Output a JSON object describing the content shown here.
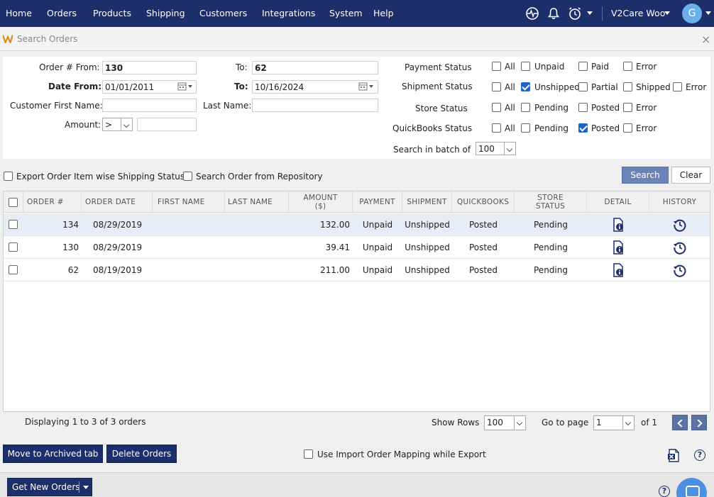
{
  "nav": {
    "items": [
      "Home",
      "Orders",
      "Products",
      "Shipping",
      "Customers",
      "Integrations",
      "System",
      "Help"
    ],
    "account": "V2Care Woo",
    "avatar_letter": "G"
  },
  "panel": {
    "title": "Search Orders",
    "close": "×"
  },
  "filter": {
    "order_from_label": "Order # From:",
    "order_from_value": "130",
    "order_to_label": "To:",
    "order_to_value": "62",
    "date_from_label": "Date From:",
    "date_from_value": "01/01/2011",
    "date_to_label": "To:",
    "date_to_value": "10/16/2024",
    "first_name_label": "Customer First Name:",
    "first_name_value": "",
    "last_name_label": "Last Name:",
    "last_name_value": "",
    "amount_label": "Amount:",
    "amount_op": ">",
    "amount_value": "",
    "payment": {
      "label": "Payment Status",
      "options": [
        {
          "label": "All",
          "checked": false
        },
        {
          "label": "Unpaid",
          "checked": false
        },
        {
          "label": "Paid",
          "checked": false
        },
        {
          "label": "Error",
          "checked": false
        }
      ]
    },
    "shipment": {
      "label": "Shipment Status",
      "options": [
        {
          "label": "All",
          "checked": false
        },
        {
          "label": "Unshipped",
          "checked": true
        },
        {
          "label": "Partial",
          "checked": false
        },
        {
          "label": "Shipped",
          "checked": false
        },
        {
          "label": "Error",
          "checked": false
        }
      ]
    },
    "store": {
      "label": "Store  Status",
      "options": [
        {
          "label": "All",
          "checked": false
        },
        {
          "label": "Pending",
          "checked": false
        },
        {
          "label": "Posted",
          "checked": false
        },
        {
          "label": "Error",
          "checked": false
        }
      ]
    },
    "quickbooks": {
      "label": "QuickBooks Status",
      "options": [
        {
          "label": "All",
          "checked": false
        },
        {
          "label": "Pending",
          "checked": false
        },
        {
          "label": "Posted",
          "checked": true
        },
        {
          "label": "Error",
          "checked": false
        }
      ]
    },
    "batch_label": "Search in batch of",
    "batch_value": "100"
  },
  "options": {
    "export_item_wise": "Export Order Item wise Shipping Status",
    "search_repository": "Search Order from Repository",
    "search_button": "Search",
    "clear_button": "Clear"
  },
  "grid": {
    "headers": [
      "ORDER #",
      "ORDER DATE",
      "FIRST NAME",
      "LAST NAME",
      "AMOUNT ($)",
      "PAYMENT",
      "SHIPMENT",
      "QUICKBOOKS",
      "STORE STATUS",
      "DETAIL",
      "HISTORY"
    ],
    "rows": [
      {
        "order": "134",
        "date": "08/29/2019",
        "first": "",
        "last": "",
        "amount": "132.00",
        "payment": "Unpaid",
        "shipment": "Unshipped",
        "quickbooks": "Posted",
        "store": "Pending"
      },
      {
        "order": "130",
        "date": "08/29/2019",
        "first": "",
        "last": "",
        "amount": "39.41",
        "payment": "Unpaid",
        "shipment": "Unshipped",
        "quickbooks": "Posted",
        "store": "Pending"
      },
      {
        "order": "62",
        "date": "08/19/2019",
        "first": "",
        "last": "",
        "amount": "211.00",
        "payment": "Unpaid",
        "shipment": "Unshipped",
        "quickbooks": "Posted",
        "store": "Pending"
      }
    ]
  },
  "footer": {
    "displaying": "Displaying 1 to 3 of 3 orders",
    "show_rows_label": "Show Rows",
    "show_rows_value": "100",
    "goto_label": "Go to page",
    "goto_value": "1",
    "of_pages": "of 1"
  },
  "actions": {
    "archive": "Move to Archived tab",
    "delete": "Delete Orders",
    "use_mapping": "Use Import Order Mapping while Export",
    "get_new_orders": "Get New Orders"
  },
  "colors": {
    "navy": "#1c2f6b",
    "accent": "#6b84b8",
    "check": "#1a66c9",
    "highlight_row": "#e6edf7"
  }
}
